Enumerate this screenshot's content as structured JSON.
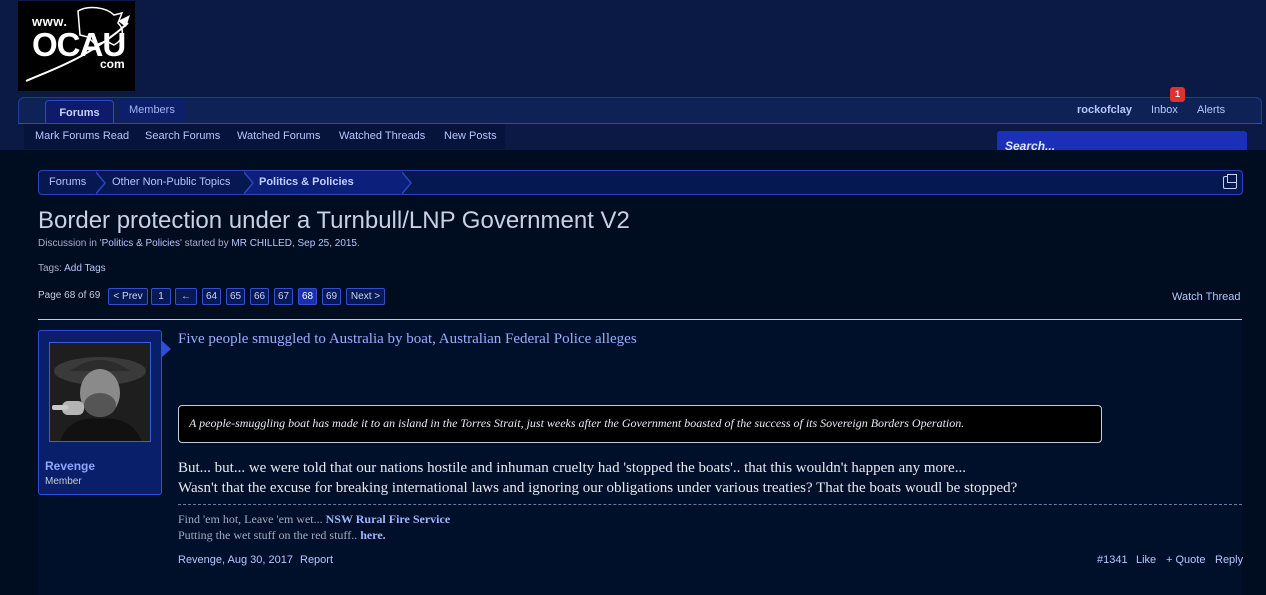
{
  "logo": {
    "www": "www.",
    "main": "OCAU",
    "com": "com"
  },
  "nav": {
    "tabs": [
      {
        "label": "Forums"
      },
      {
        "label": "Members"
      }
    ],
    "user": "rockofclay",
    "inbox": "Inbox",
    "inbox_badge": "1",
    "alerts": "Alerts",
    "sub": [
      "Mark Forums Read",
      "Search Forums",
      "Watched Forums",
      "Watched Threads",
      "New Posts"
    ]
  },
  "search": {
    "placeholder": "Search..."
  },
  "breadcrumbs": [
    "Forums",
    "Other Non-Public Topics",
    "Politics & Policies"
  ],
  "thread": {
    "title": "Border protection under a Turnbull/LNP Government V2",
    "meta_prefix": "Discussion in '",
    "meta_forum": "Politics & Policies",
    "meta_mid": "' started by ",
    "meta_author": "MR CHILLED",
    "meta_sep": ", ",
    "meta_date": "Sep 25, 2015",
    "meta_end": ".",
    "tags_label": "Tags: ",
    "add_tags": "Add Tags",
    "watch": "Watch Thread"
  },
  "pagination": {
    "info": "Page 68 of 69",
    "prev": "< Prev",
    "first": "1",
    "skip": "←",
    "pages": [
      "64",
      "65",
      "66",
      "67",
      "68",
      "69"
    ],
    "current": "68",
    "next": "Next >"
  },
  "post": {
    "username": "Revenge",
    "user_title": "Member",
    "link_title": "Five people smuggled to Australia by boat, Australian Federal Police alleges",
    "quote": "A people-smuggling boat has made it to an island in the Torres Strait, just weeks after the Government boasted of the success of its Sovereign Borders Operation.",
    "body_line1": "But... but... we were told that our nations hostile and inhuman cruelty had 'stopped the boats'.. that this wouldn't happen any more...",
    "body_line2": "Wasn't that the excuse for breaking international laws and ignoring our obligations under various treaties? That the boats woudl be stopped?",
    "sig1_text": "Find 'em hot, Leave 'em wet... ",
    "sig1_link": "NSW Rural Fire Service",
    "sig2_text": "Putting the wet stuff on the red stuff.. ",
    "sig2_link": "here.",
    "author_date": "Revenge, Aug 30, 2017",
    "report": "Report",
    "number": "#1341",
    "like": "Like",
    "quote_btn": "+ Quote",
    "reply": "Reply"
  }
}
